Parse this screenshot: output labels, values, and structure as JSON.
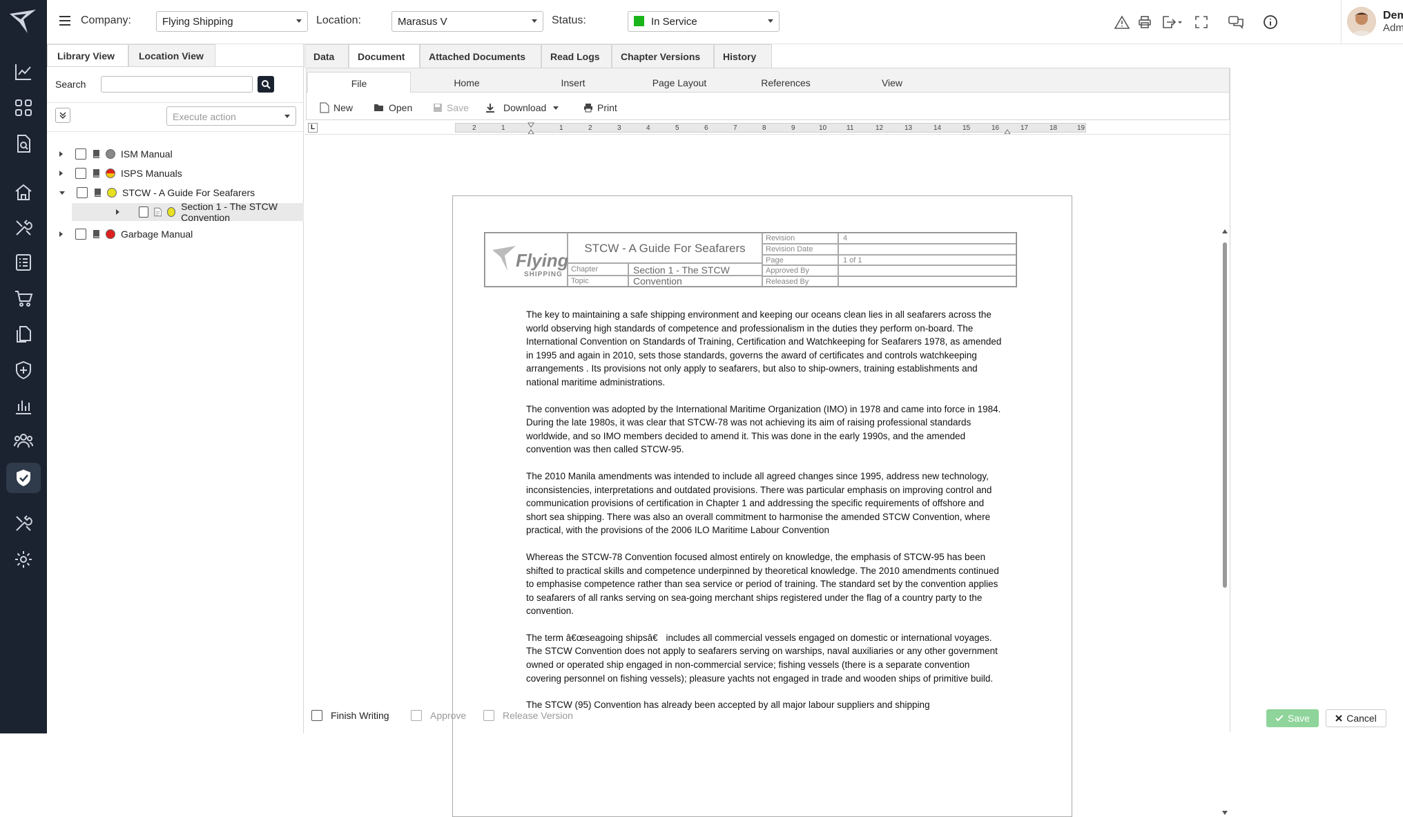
{
  "topbar": {
    "company_label": "Company:",
    "company_value": "Flying Shipping",
    "location_label": "Location:",
    "location_value": "Marasus V",
    "status_label": "Status:",
    "status_value": "In Service",
    "status_color": "#1bb51b",
    "icons": [
      "alert-icon",
      "print-icon",
      "export-icon",
      "fullscreen-icon",
      "chat-icon",
      "info-icon"
    ]
  },
  "user": {
    "name": "Demo User",
    "role": "Admin"
  },
  "sidebar": {
    "icons": [
      "chart-line-icon",
      "grid-icon",
      "document-search-icon",
      "home-icon",
      "tools-icon",
      "checklist-icon",
      "cart-icon",
      "files-icon",
      "shield-plus-icon",
      "bar-chart-icon",
      "users-icon",
      "shield-check-icon",
      "wrench-icon",
      "gear-icon"
    ],
    "active": "shield-check-icon"
  },
  "left_panel": {
    "tabs": [
      "Library View",
      "Location View"
    ],
    "search_label": "Search",
    "search_placeholder": "",
    "execute_placeholder": "Execute action",
    "tree": [
      {
        "label": "ISM Manual",
        "status_color": "#888888"
      },
      {
        "label": "ISPS Manuals",
        "status_color": "#e2231a"
      },
      {
        "label": "STCW - A Guide For Seafarers",
        "status_color": "#e8e020"
      },
      {
        "label": "Section 1 - The STCW Convention",
        "status_color": "#e8e020"
      },
      {
        "label": "Garbage Manual",
        "status_color": "#dd2020"
      }
    ]
  },
  "main": {
    "tabs": [
      "Data",
      "Document",
      "Attached Documents",
      "Read Logs",
      "Chapter Versions",
      "History"
    ],
    "active_tab": "Document",
    "ribbon_tabs": [
      "File",
      "Home",
      "Insert",
      "Page Layout",
      "References",
      "View"
    ],
    "file_actions": {
      "new": "New",
      "open": "Open",
      "save": "Save",
      "download": "Download",
      "print": "Print"
    },
    "ruler_marks": [
      "2",
      "1",
      "1",
      "2",
      "3",
      "4",
      "5",
      "6",
      "7",
      "8",
      "9",
      "10",
      "11",
      "12",
      "13",
      "14",
      "15",
      "16",
      "17",
      "18",
      "19"
    ],
    "ruler_tab_label": "L"
  },
  "document": {
    "logo_word": "Flying",
    "logo_sub": "SHIPPING",
    "title": "STCW - A Guide For Seafarers",
    "chapter_label": "Chapter",
    "chapter_value": "Section 1 - The STCW Convention",
    "topic_label": "Topic",
    "meta": {
      "revision_label": "Revision",
      "revision_value": "4",
      "revision_date_label": "Revision Date",
      "revision_date_value": "",
      "page_label": "Page",
      "page_value": "1 of 1",
      "approved_label": "Approved By",
      "approved_value": "",
      "released_label": "Released By",
      "released_value": ""
    },
    "paragraphs": [
      "The key to maintaining a safe shipping environment and keeping our oceans clean lies in all seafarers across the world observing high standards of competence and professionalism in the duties they perform on-board. The International Convention on Standards of Training, Certification and Watchkeeping for Seafarers 1978, as amended in 1995 and again in 2010, sets those standards, governs the award of certificates and controls watchkeeping arrangements . Its provisions not only apply to seafarers, but also to ship-owners, training establishments and national maritime administrations.",
      "The convention was adopted by the International Maritime Organization (IMO) in 1978 and came into force in 1984. During the late 1980s, it was clear that STCW-78 was not achieving its aim of raising professional standards worldwide, and so IMO members decided to amend it. This was done in the early 1990s, and the amended convention was then called STCW-95.",
      "The 2010 Manila amendments was intended to include all agreed changes since 1995, address new technology, inconsistencies, interpretations and outdated provisions. There was particular emphasis on improving control and communication provisions of certification in Chapter 1 and addressing the specific requirements of offshore and short sea shipping. There was also an overall commitment to harmonise the amended STCW Convention, where practical, with the provisions of the 2006 ILO Maritime Labour Convention",
      "Whereas the STCW-78 Convention focused almost entirely on knowledge, the emphasis of STCW-95 has been shifted to practical skills and competence underpinned by theoretical knowledge. The 2010 amendments continued to emphasise competence rather than sea service or period of training. The standard set by the convention applies to seafarers of all ranks serving on sea-going merchant ships registered under the flag of a country party to the convention.",
      "The term â€œseagoing shipsâ€ includes all commercial vessels engaged on domestic or international voyages. The STCW Convention does not apply to seafarers serving on warships, naval auxiliaries or any other government owned or operated ship engaged in non-commercial service; fishing vessels (there is a separate convention covering personnel on fishing vessels); pleasure yachts not engaged in trade and wooden ships of primitive build.",
      "The STCW (95) Convention has already been accepted by all major labour suppliers and shipping"
    ]
  },
  "footer": {
    "finish_writing": "Finish Writing",
    "approve": "Approve",
    "release_version": "Release Version",
    "save": "Save",
    "cancel": "Cancel"
  }
}
